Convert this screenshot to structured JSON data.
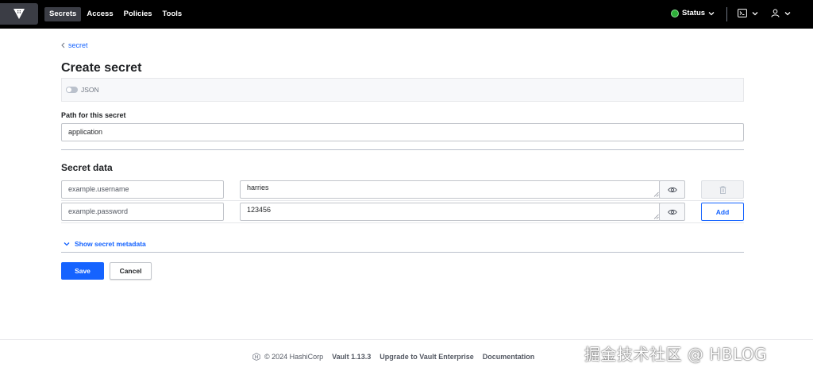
{
  "nav": {
    "items": [
      {
        "label": "Secrets",
        "active": true
      },
      {
        "label": "Access",
        "active": false
      },
      {
        "label": "Policies",
        "active": false
      },
      {
        "label": "Tools",
        "active": false
      }
    ],
    "status_label": "Status",
    "status_color": "#2eb039"
  },
  "breadcrumb": {
    "label": "secret"
  },
  "page": {
    "title": "Create secret"
  },
  "json_toggle": {
    "label": "JSON",
    "enabled": false
  },
  "path": {
    "label": "Path for this secret",
    "value": "application"
  },
  "secret_data": {
    "title": "Secret data",
    "rows": [
      {
        "key_placeholder": "example.username",
        "value": "harries",
        "action": "delete"
      },
      {
        "key_placeholder": "example.password",
        "value": "123456",
        "action": "Add"
      }
    ]
  },
  "metadata": {
    "toggle_label": "Show secret metadata"
  },
  "actions": {
    "save_label": "Save",
    "cancel_label": "Cancel"
  },
  "footer": {
    "copyright": "© 2024 HashiCorp",
    "version": "Vault 1.13.3",
    "upgrade": "Upgrade to Vault Enterprise",
    "docs": "Documentation"
  },
  "watermark": "掘金技术社区 @ HBLOG",
  "colors": {
    "accent": "#1563ff",
    "topbar": "#000000"
  }
}
